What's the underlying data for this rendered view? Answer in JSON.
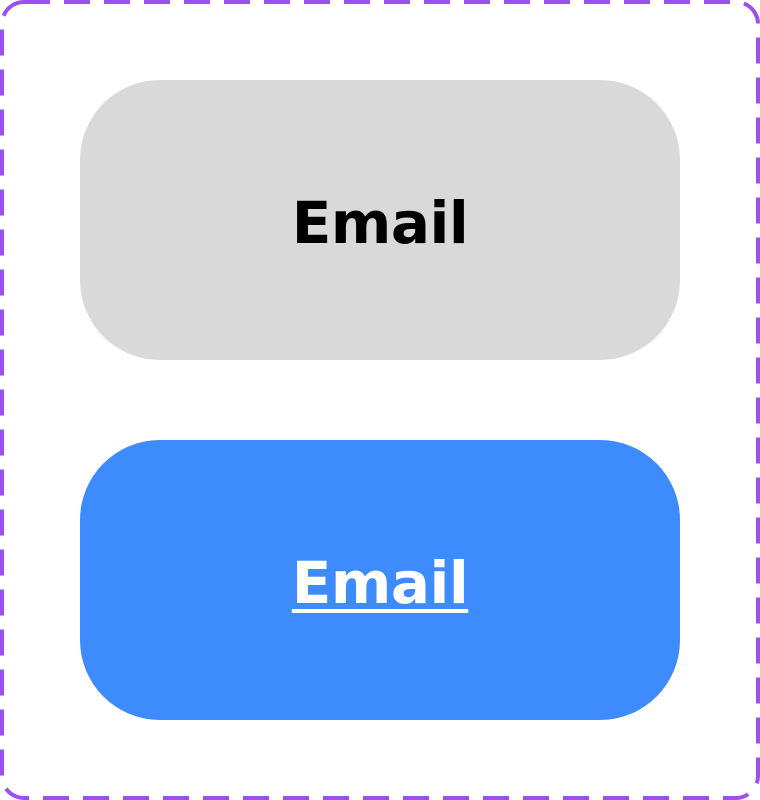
{
  "frame": {
    "border_color": "#9b51f0",
    "style": "dashed"
  },
  "buttons": [
    {
      "state": "default",
      "label": "Email",
      "background": "#d9d9d9",
      "text_color": "#000000",
      "underlined": false
    },
    {
      "state": "hover",
      "label": "Email",
      "background": "#3d8bfd",
      "text_color": "#ffffff",
      "underlined": true
    }
  ]
}
